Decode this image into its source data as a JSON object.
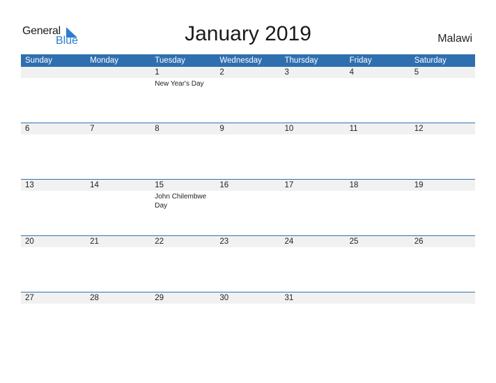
{
  "logo": {
    "word1": "General",
    "word2": "Blue",
    "accent": "#2a7fd0"
  },
  "title": "January 2019",
  "country": "Malawi",
  "colors": {
    "header_bg": "#2f6fb0",
    "band_bg": "#f1f1f1"
  },
  "weekdays": [
    "Sunday",
    "Monday",
    "Tuesday",
    "Wednesday",
    "Thursday",
    "Friday",
    "Saturday"
  ],
  "weeks": [
    [
      {
        "d": ""
      },
      {
        "d": ""
      },
      {
        "d": "1",
        "e": "New Year's Day"
      },
      {
        "d": "2"
      },
      {
        "d": "3"
      },
      {
        "d": "4"
      },
      {
        "d": "5"
      }
    ],
    [
      {
        "d": "6"
      },
      {
        "d": "7"
      },
      {
        "d": "8"
      },
      {
        "d": "9"
      },
      {
        "d": "10"
      },
      {
        "d": "11"
      },
      {
        "d": "12"
      }
    ],
    [
      {
        "d": "13"
      },
      {
        "d": "14"
      },
      {
        "d": "15",
        "e": "John Chilembwe Day"
      },
      {
        "d": "16"
      },
      {
        "d": "17"
      },
      {
        "d": "18"
      },
      {
        "d": "19"
      }
    ],
    [
      {
        "d": "20"
      },
      {
        "d": "21"
      },
      {
        "d": "22"
      },
      {
        "d": "23"
      },
      {
        "d": "24"
      },
      {
        "d": "25"
      },
      {
        "d": "26"
      }
    ],
    [
      {
        "d": "27"
      },
      {
        "d": "28"
      },
      {
        "d": "29"
      },
      {
        "d": "30"
      },
      {
        "d": "31"
      },
      {
        "d": ""
      },
      {
        "d": ""
      }
    ]
  ]
}
